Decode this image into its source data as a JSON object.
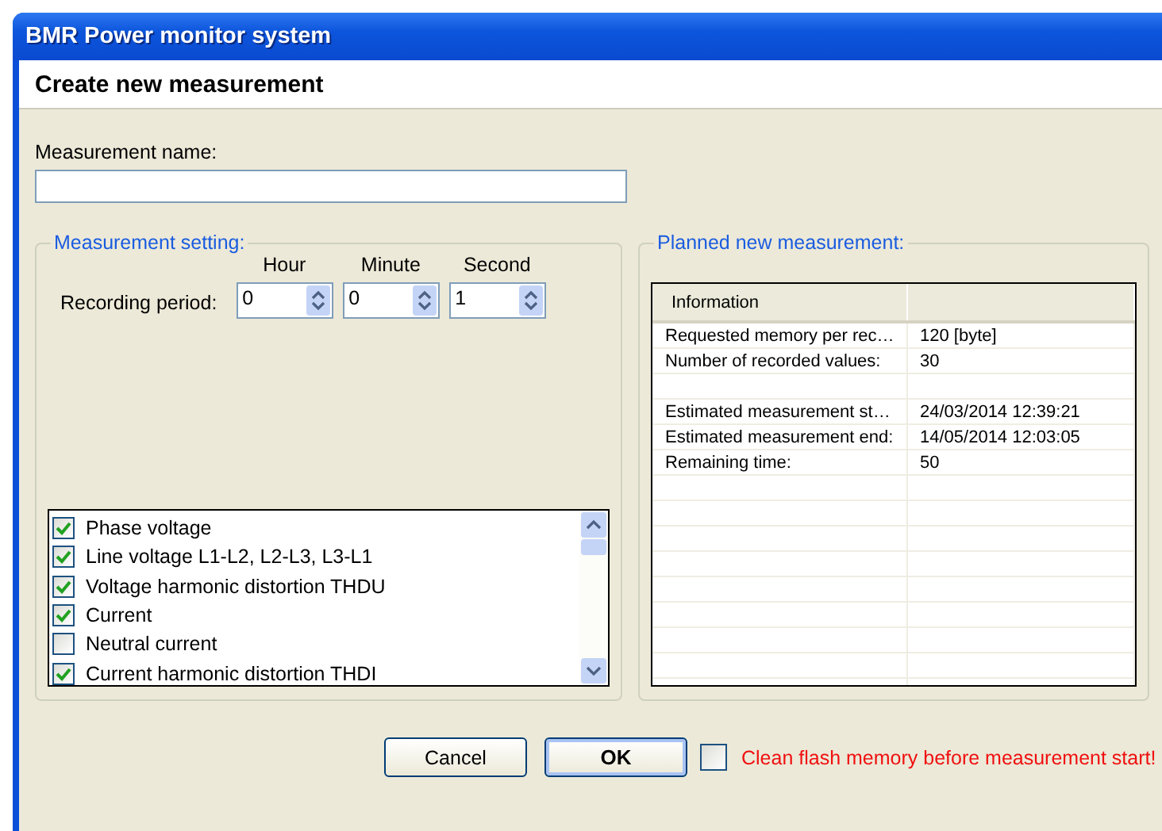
{
  "window": {
    "title": "BMR Power monitor system"
  },
  "header": {
    "title": "Create new measurement"
  },
  "name_field": {
    "label": "Measurement name:"
  },
  "measurement_setting": {
    "title": "Measurement setting:",
    "recording_label": "Recording period:",
    "spinners": [
      {
        "label": "Hour",
        "value": "0"
      },
      {
        "label": "Minute",
        "value": "0"
      },
      {
        "label": "Second",
        "value": "1"
      }
    ],
    "quantities": [
      {
        "label": "Phase voltage",
        "checked": true
      },
      {
        "label": "Line voltage L1-L2, L2-L3, L3-L1",
        "checked": true
      },
      {
        "label": "Voltage harmonic distortion THDU",
        "checked": true
      },
      {
        "label": "Current",
        "checked": true
      },
      {
        "label": "Neutral current",
        "checked": false
      },
      {
        "label": "Current harmonic distortion THDI",
        "checked": true
      }
    ]
  },
  "planned": {
    "title": "Planned new measurement:",
    "table": {
      "columns": [
        "Information"
      ],
      "rows": [
        {
          "name": "Requested memory per rec…",
          "value": "120 [byte]"
        },
        {
          "name": "Number of recorded values:",
          "value": "30"
        },
        {},
        {
          "name": "Estimated measurement st…",
          "value": "24/03/2014 12:39:21"
        },
        {
          "name": "Estimated measurement end:",
          "value": "14/05/2014 12:03:05"
        },
        {
          "name": "Remaining time:",
          "value": "50"
        }
      ]
    }
  },
  "buttons": [
    {
      "label": "Cancel",
      "default": false
    },
    {
      "label": "OK",
      "default": true
    }
  ],
  "clean_flash": {
    "label": "Clean flash memory before measurement start!",
    "checked": false
  }
}
